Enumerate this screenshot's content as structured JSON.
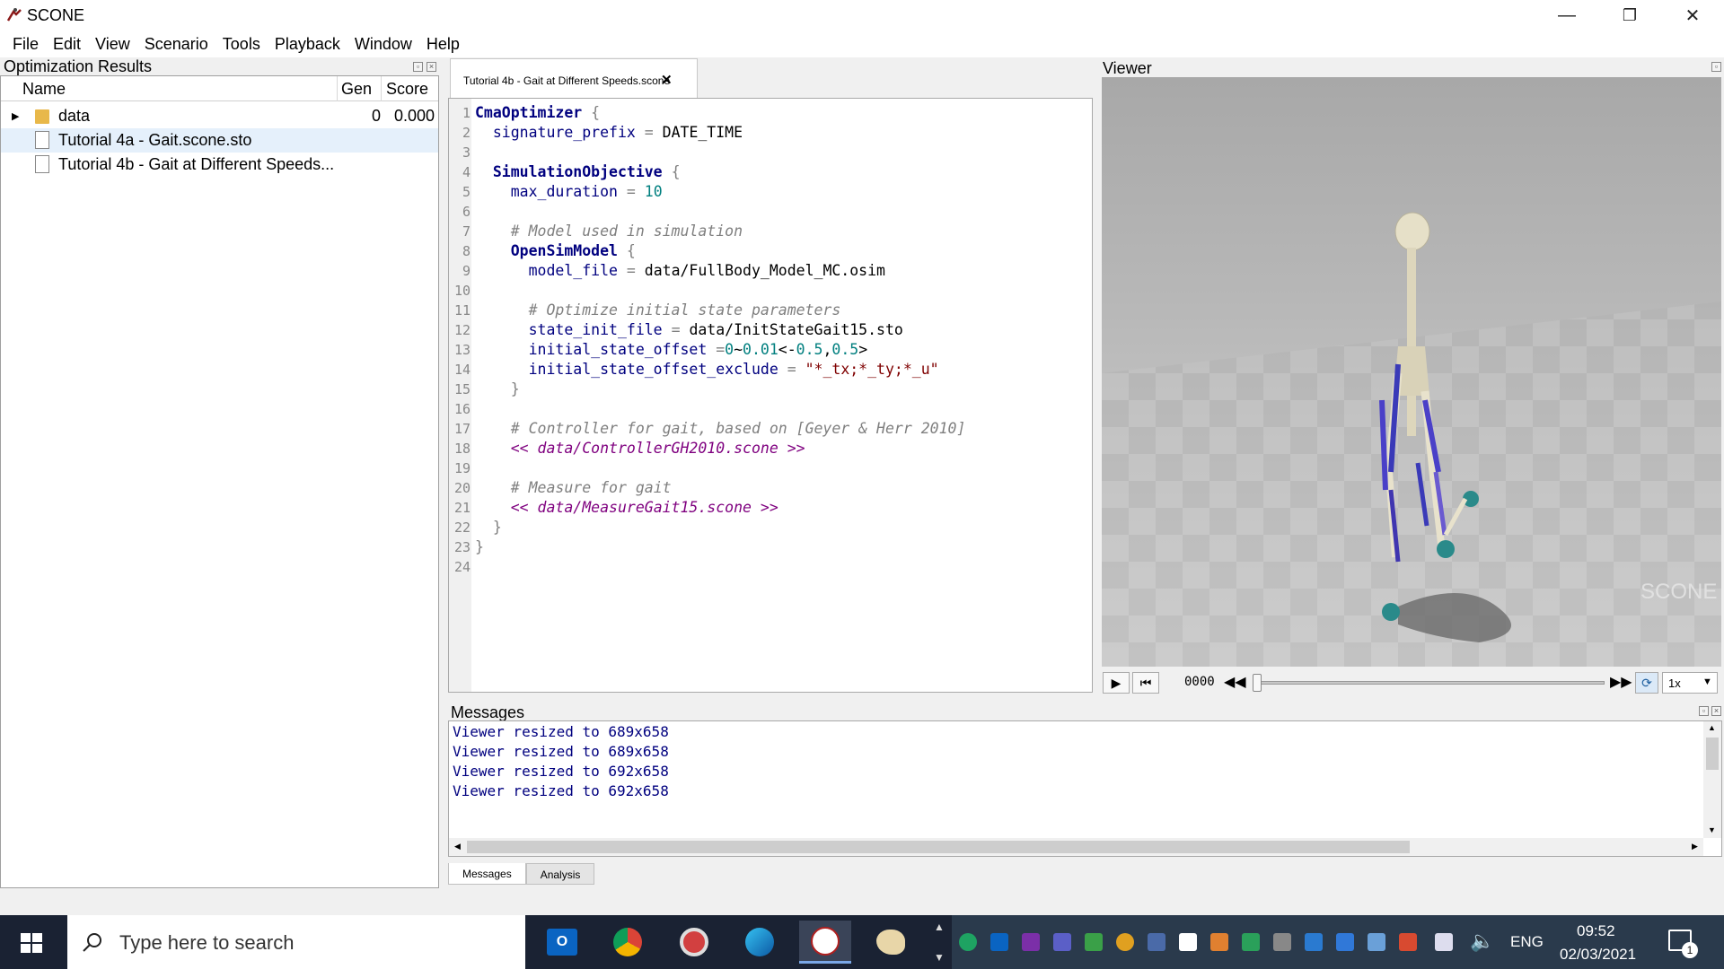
{
  "window": {
    "title": "SCONE",
    "minimize": "—",
    "maximize": "❐",
    "close": "✕"
  },
  "menu": [
    "File",
    "Edit",
    "View",
    "Scenario",
    "Tools",
    "Playback",
    "Window",
    "Help"
  ],
  "results": {
    "title": "Optimization Results",
    "columns": {
      "name": "Name",
      "gen": "Gen",
      "score": "Score"
    },
    "rows": [
      {
        "name": "data",
        "gen": "0",
        "score": "0.000",
        "type": "folder"
      },
      {
        "name": "Tutorial 4a - Gait.scone.sto",
        "gen": "",
        "score": "",
        "type": "file"
      },
      {
        "name": "Tutorial 4b - Gait at Different Speeds...",
        "gen": "",
        "score": "",
        "type": "file"
      }
    ]
  },
  "editor": {
    "tab_label": "Tutorial 4b - Gait at Different Speeds.scone",
    "tab_close": "✕"
  },
  "viewer": {
    "title": "Viewer",
    "watermark": "SCONE",
    "time_display": "0000",
    "speed": "1x",
    "icons": [
      "play-icon",
      "rewind-start-icon",
      "step-back-icon",
      "step-forward-icon",
      "loop-icon"
    ],
    "slider_position_fraction": 0.0
  },
  "messages": {
    "title": "Messages",
    "lines": [
      "Viewer resized to 689x658",
      "Viewer resized to 689x658",
      "Viewer resized to 692x658",
      "Viewer resized to 692x658"
    ],
    "tabs": [
      "Messages",
      "Analysis"
    ]
  },
  "taskbar": {
    "search_placeholder": "Type here to search",
    "language": "ENG",
    "time": "09:52",
    "date": "02/03/2021",
    "notifications": "1"
  },
  "colors": {
    "keyword": "#00007f",
    "comment": "#7f7f7f",
    "include": "#7f007f",
    "number": "#007f7f",
    "string": "#7f0000",
    "taskbar": "#1a2233"
  }
}
